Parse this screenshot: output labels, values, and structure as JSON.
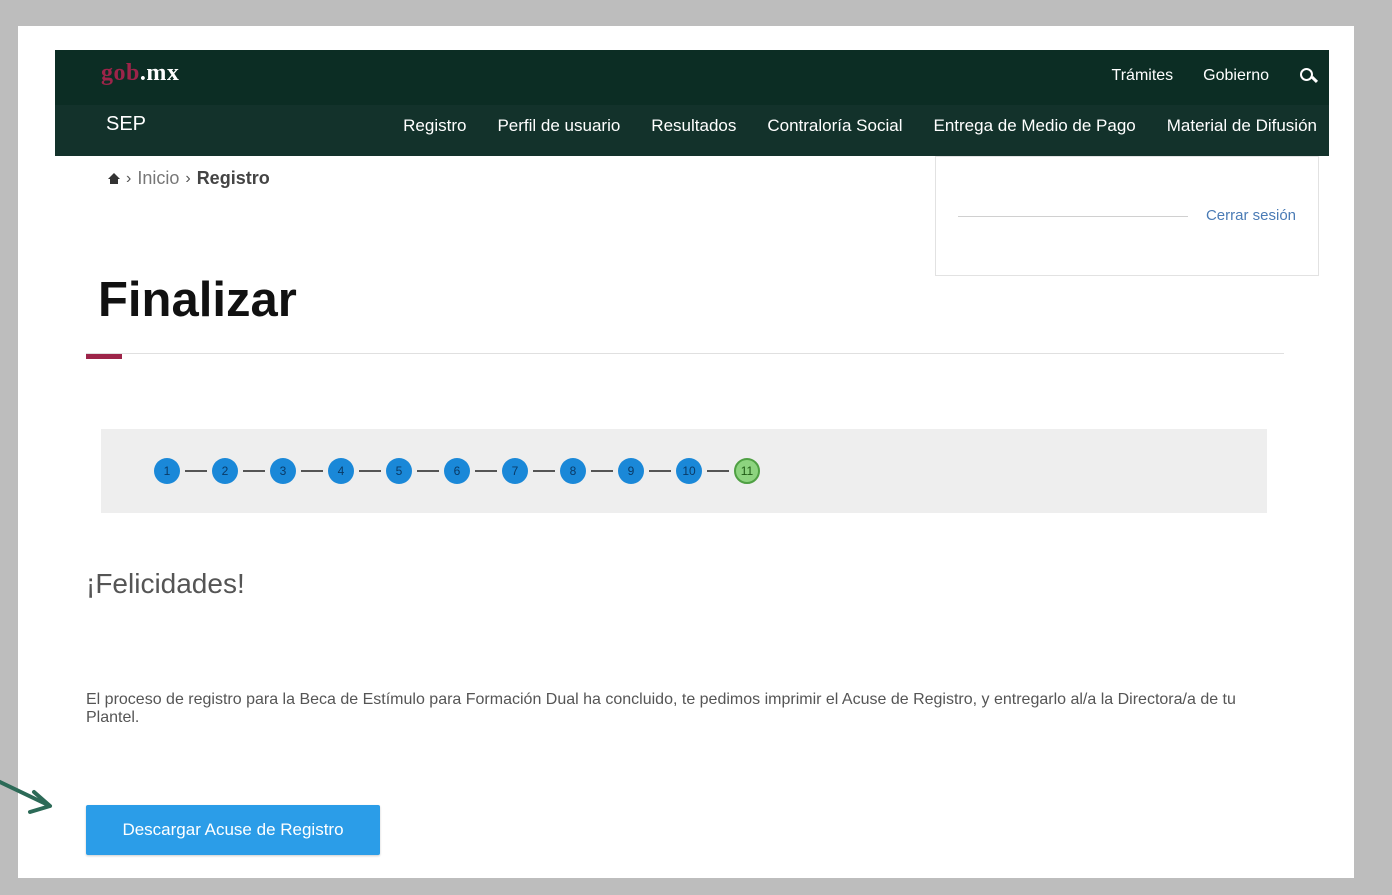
{
  "header": {
    "logo_prefix": "gob",
    "logo_suffix": ".mx",
    "top_links": [
      "Trámites",
      "Gobierno"
    ],
    "agency": "SEP",
    "nav": [
      "Registro",
      "Perfil de usuario",
      "Resultados",
      "Contraloría Social",
      "Entrega de Medio de Pago",
      "Material de Difusión"
    ]
  },
  "breadcrumb": {
    "sep": "›",
    "inicio": "Inicio",
    "current": "Registro"
  },
  "session": {
    "logout": "Cerrar sesión"
  },
  "main": {
    "title": "Finalizar",
    "steps": [
      "1",
      "2",
      "3",
      "4",
      "5",
      "6",
      "7",
      "8",
      "9",
      "10",
      "11"
    ],
    "congrats": "¡Felicidades!",
    "message": "El proceso de registro para la Beca de Estímulo para Formación Dual ha concluido, te pedimos imprimir el Acuse de Registro, y entregarlo al/a la Directora/a de tu Plantel.",
    "download_label": "Descargar Acuse de Registro"
  },
  "colors": {
    "header_bg": "#0c2d24",
    "nav_bg": "#13322b",
    "accent": "#9d2449",
    "step_active": "#1a88d8",
    "step_done": "#8dd47f",
    "button": "#2b9de8"
  }
}
